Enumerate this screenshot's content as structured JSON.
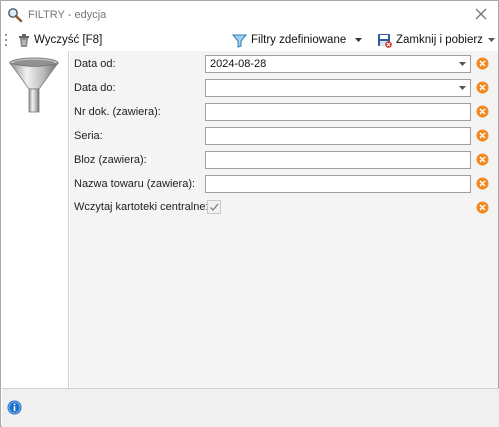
{
  "window": {
    "title": "FILTRY - edycja"
  },
  "toolbar": {
    "clear_label": "Wyczyść [F8]",
    "defined_filters_label": "Filtry zdefiniowane",
    "close_and_fetch_label": "Zamknij i pobierz"
  },
  "form": {
    "date_from": {
      "label": "Data od:",
      "value": "2024-08-28"
    },
    "date_to": {
      "label": "Data do:",
      "value": ""
    },
    "doc_number": {
      "label": "Nr dok. (zawiera):",
      "value": ""
    },
    "series": {
      "label": "Seria:",
      "value": ""
    },
    "bloz": {
      "label": "Bloz (zawiera):",
      "value": ""
    },
    "product_name": {
      "label": "Nazwa towaru (zawiera):",
      "value": ""
    },
    "central_cards": {
      "label": "Wczytaj kartoteki centralne:",
      "checked": true
    }
  },
  "icons": {
    "title": "magnifier-icon",
    "clear": "trash-icon",
    "defined_filters": "funnel-icon",
    "close_and_fetch": "save-close-icon",
    "sidebar": "funnel-icon",
    "field_clear": "clear-x-icon",
    "status": "info-icon"
  },
  "colors": {
    "clear_button": "#f08a1c",
    "info": "#1e6fc9",
    "content_background": "#f4f4f4"
  }
}
